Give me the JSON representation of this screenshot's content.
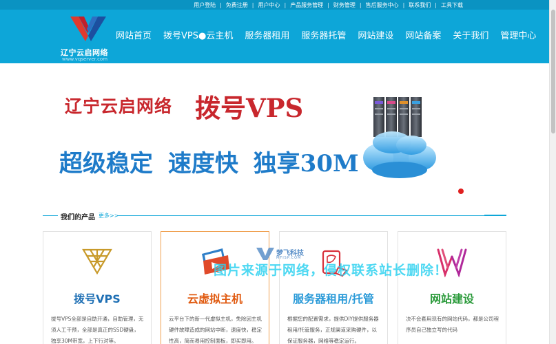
{
  "top_links": [
    "用户登陆",
    "免费注册",
    "用户中心",
    "产品服务管理",
    "财务管理",
    "售后服务中心",
    "联系我们",
    "工具下载"
  ],
  "logo": {
    "name": "辽宁云启网络",
    "url": "www.vqserver.com"
  },
  "nav": [
    "网站首页",
    "拨号VPS●云主机",
    "服务器租用",
    "服务器托管",
    "网站建设",
    "网站备案",
    "关于我们",
    "管理中心"
  ],
  "banner": {
    "company": "辽宁云启网络",
    "product": "拨号VPS",
    "slogan": "超级稳定 速度快 独享30M"
  },
  "products_heading": {
    "title": "我们的产品",
    "more": "更多>>"
  },
  "cards": [
    {
      "title": "拨号VPS",
      "title_color": "#1e6fb4",
      "desc": "拔号VPS全部是自助开通，自助管理，无须人工干预，全部是真正的SSD硬盘，独享30M带宽，上下行对等。",
      "icon": "triangle-pyramid-icon"
    },
    {
      "title": "云虚拟主机",
      "title_color": "#e05a10",
      "desc": "云平台下的新一代虚拟主机，免除因主机硬件故障造成的网站中断，速度快，稳定性高，简而易用控制面板，即买即用。",
      "icon": "play-window-icon"
    },
    {
      "title": "服务器租用/托管",
      "title_color": "#2a9ad8",
      "desc": "根据您的配置需求，提供DIY提供服务器租用/托管服务，正规渠道采购硬件，以保证服务器，网络等稳定运行。",
      "icon": "server-box-icon"
    },
    {
      "title": "网站建设",
      "title_color": "#2a9a3a",
      "desc": "决不会套用现有的网站代码，都是公司程序员自己独立写的代码",
      "icon": "w-letter-icon"
    }
  ],
  "watermark": {
    "text": "图片来源于网络，侵权联系站长删除！",
    "brand": "梦飞科技",
    "brand_sub": "MFISP.COM"
  },
  "colors": {
    "header_bg": "#0da6d8",
    "topbar_bg": "#0a93c2",
    "banner_red": "#c8272d",
    "banner_blue": "#1e7bc9"
  }
}
